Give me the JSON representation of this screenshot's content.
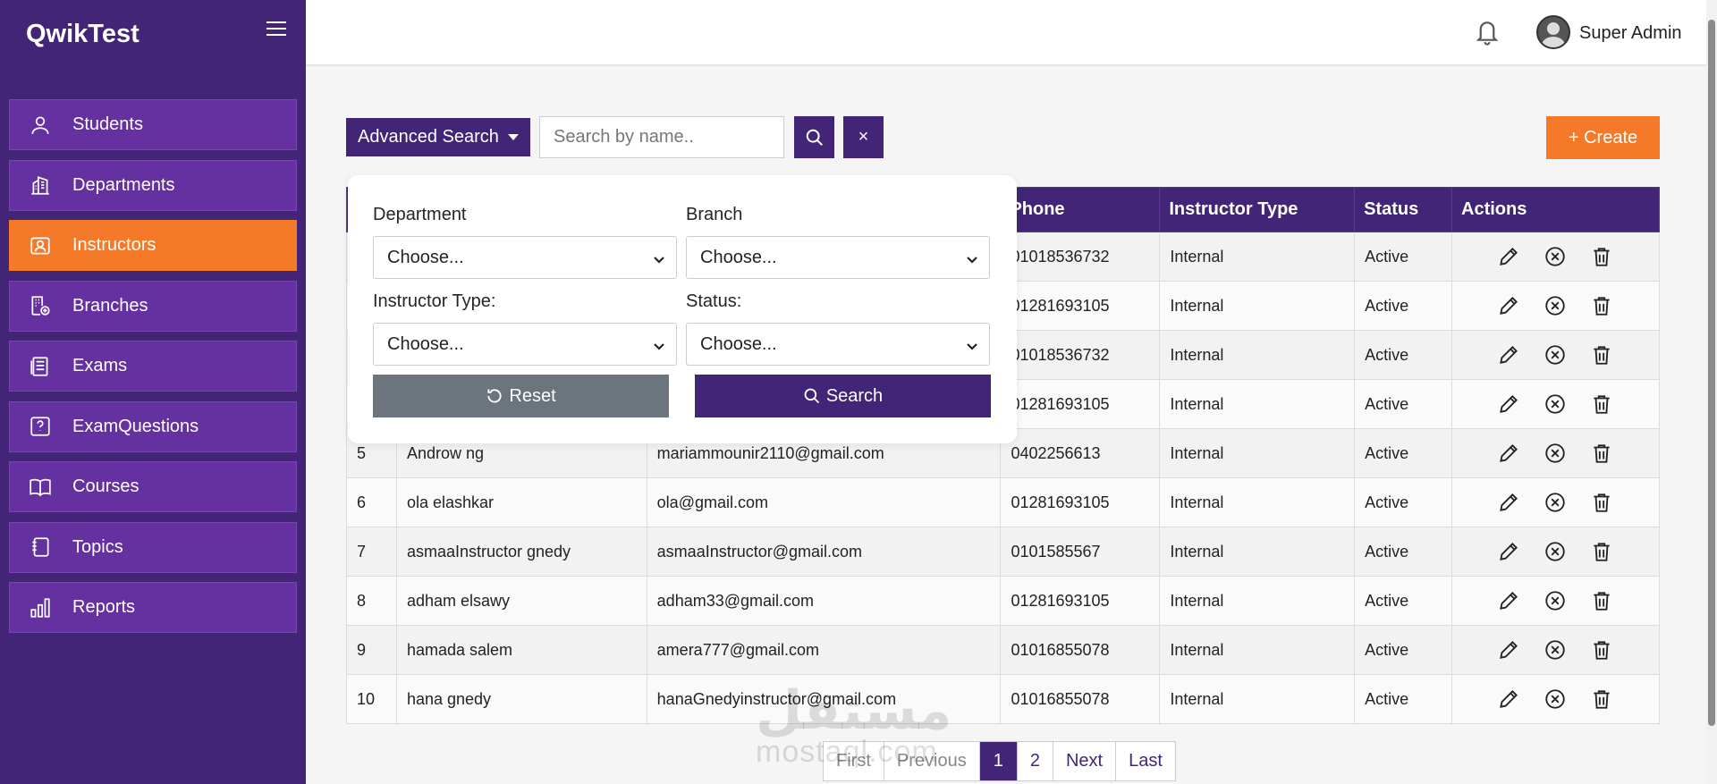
{
  "app": {
    "brand": "QwikTest"
  },
  "sidebar": {
    "items": [
      {
        "label": "Students",
        "icon": "user-icon",
        "active": false
      },
      {
        "label": "Departments",
        "icon": "building-icon",
        "active": false
      },
      {
        "label": "Instructors",
        "icon": "id-card-icon",
        "active": true
      },
      {
        "label": "Branches",
        "icon": "office-branch-icon",
        "active": false
      },
      {
        "label": "Exams",
        "icon": "document-list-icon",
        "active": false
      },
      {
        "label": "ExamQuestions",
        "icon": "question-square-icon",
        "active": false
      },
      {
        "label": "Courses",
        "icon": "book-icon",
        "active": false
      },
      {
        "label": "Topics",
        "icon": "journal-icon",
        "active": false
      },
      {
        "label": "Reports",
        "icon": "bar-chart-icon",
        "active": false
      }
    ]
  },
  "header": {
    "user_name": "Super Admin"
  },
  "toolbar": {
    "advanced_search_label": "Advanced Search",
    "search_placeholder": "Search by name..",
    "clear_label": "×",
    "create_label": "+ Create"
  },
  "advanced_search": {
    "department_label": "Department",
    "department_value": "Choose...",
    "branch_label": "Branch",
    "branch_value": "Choose...",
    "instructor_type_label": "Instructor Type:",
    "instructor_type_value": "Choose...",
    "status_label": "Status:",
    "status_value": "Choose...",
    "reset_label": "Reset",
    "search_label": "Search"
  },
  "table": {
    "columns": [
      "",
      "",
      "",
      "Phone",
      "Instructor Type",
      "Status",
      "Actions"
    ],
    "rows": [
      {
        "num": "",
        "name": "",
        "email": "",
        "phone": "01018536732",
        "type": "Internal",
        "status": "Active"
      },
      {
        "num": "",
        "name": "",
        "email": "",
        "phone": "01281693105",
        "type": "Internal",
        "status": "Active"
      },
      {
        "num": "",
        "name": "",
        "email": "",
        "phone": "01018536732",
        "type": "Internal",
        "status": "Active"
      },
      {
        "num": "",
        "name": "",
        "email": "",
        "phone": "01281693105",
        "type": "Internal",
        "status": "Active"
      },
      {
        "num": "5",
        "name": "Androw ng",
        "email": "mariammounir2110@gmail.com",
        "phone": "0402256613",
        "type": "Internal",
        "status": "Active"
      },
      {
        "num": "6",
        "name": "ola elashkar",
        "email": "ola@gmail.com",
        "phone": "01281693105",
        "type": "Internal",
        "status": "Active"
      },
      {
        "num": "7",
        "name": "asmaaInstructor gnedy",
        "email": "asmaaInstructor@gmail.com",
        "phone": "0101585567",
        "type": "Internal",
        "status": "Active"
      },
      {
        "num": "8",
        "name": "adham elsawy",
        "email": "adham33@gmail.com",
        "phone": "01281693105",
        "type": "Internal",
        "status": "Active"
      },
      {
        "num": "9",
        "name": "hamada salem",
        "email": "amera777@gmail.com",
        "phone": "01016855078",
        "type": "Internal",
        "status": "Active"
      },
      {
        "num": "10",
        "name": "hana gnedy",
        "email": "hanaGnedyinstructor@gmail.com",
        "phone": "01016855078",
        "type": "Internal",
        "status": "Active"
      }
    ]
  },
  "pagination": {
    "first": "First",
    "previous": "Previous",
    "pages": [
      "1",
      "2"
    ],
    "current": "1",
    "next": "Next",
    "last": "Last"
  },
  "watermark": {
    "logo": "مستقل",
    "text": "mostaql.com"
  },
  "colors": {
    "sidebar_bg": "#432577",
    "nav_item_bg": "#6530a0",
    "accent_orange": "#f47a2a",
    "primary_purple": "#432577",
    "status_green": "#198754",
    "reset_gray": "#6c757d"
  }
}
